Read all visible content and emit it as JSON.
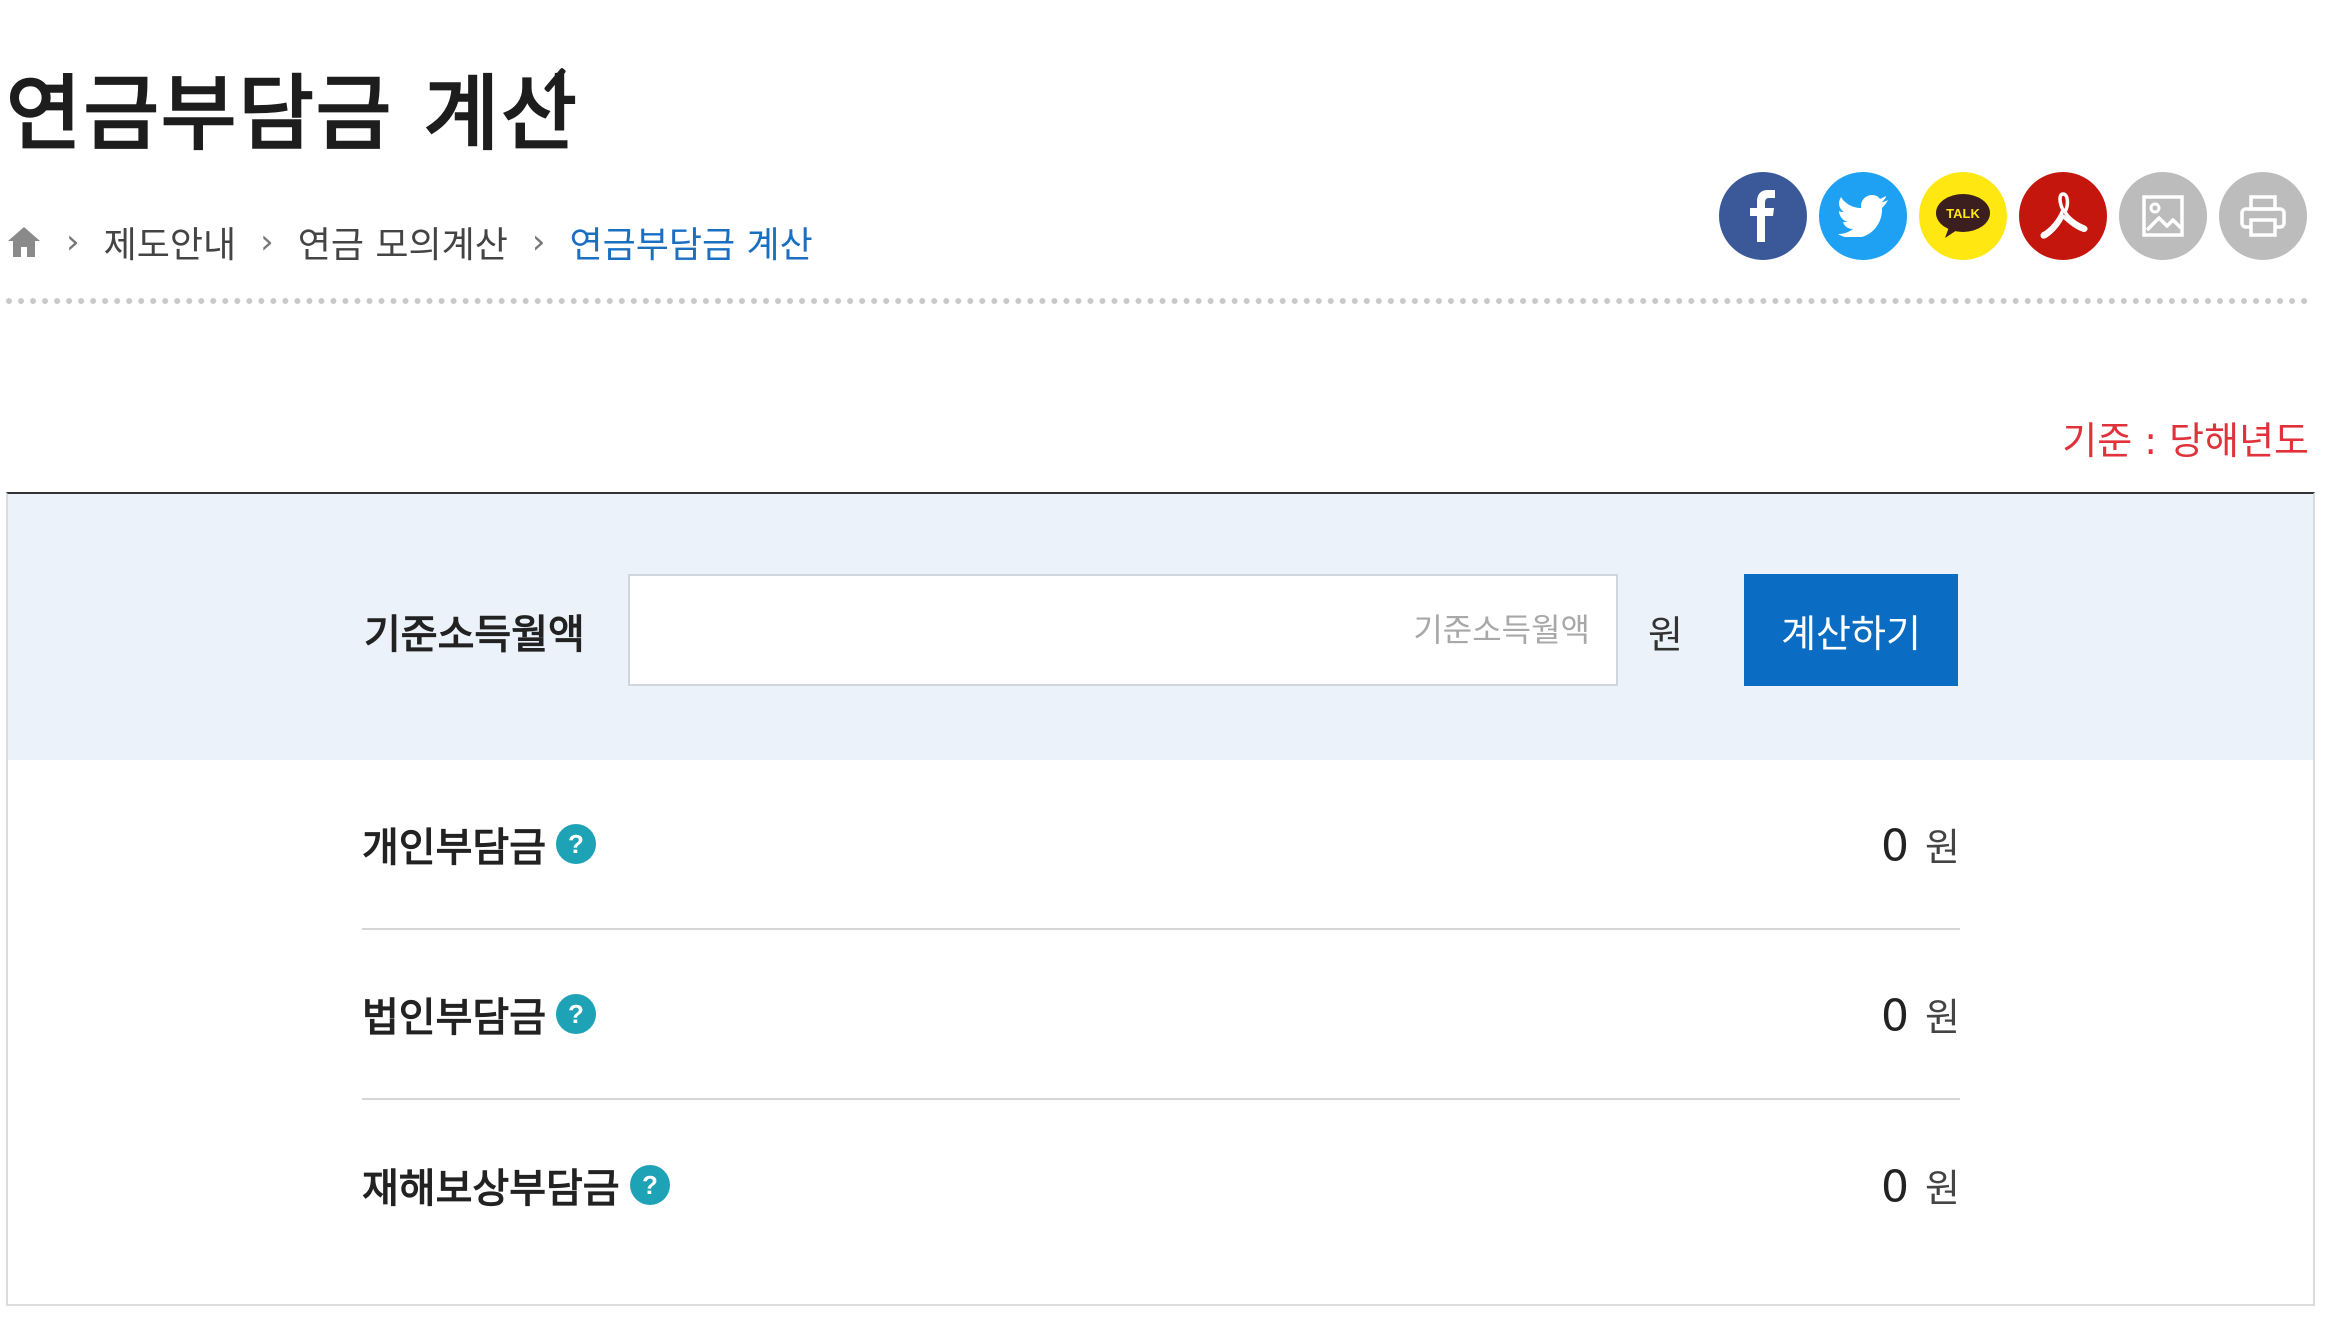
{
  "page": {
    "title": "연금부담금 계산"
  },
  "breadcrumb": {
    "home_icon": "home-icon",
    "items": [
      "제도안내",
      "연금 모의계산",
      "연금부담금 계산"
    ]
  },
  "share": {
    "icons": [
      "facebook-icon",
      "twitter-icon",
      "kakaotalk-icon",
      "pdf-icon",
      "image-save-icon",
      "print-icon"
    ],
    "kakao_text": "TALK"
  },
  "basis": {
    "text": "기준 : 당해년도"
  },
  "calculator": {
    "input_label": "기준소득월액",
    "input_placeholder": "기준소득월액",
    "input_value": "",
    "unit": "원",
    "button_label": "계산하기"
  },
  "results": [
    {
      "label": "개인부담금",
      "value": "0",
      "unit": "원"
    },
    {
      "label": "법인부담금",
      "value": "0",
      "unit": "원"
    },
    {
      "label": "재해보상부담금",
      "value": "0",
      "unit": "원"
    }
  ],
  "colors": {
    "accent": "#0a6cc2",
    "breadcrumb_current": "#1a6fc0",
    "basis_text": "#e0323a",
    "input_band": "#ebf2fa",
    "help_icon": "#1ea2b6"
  }
}
